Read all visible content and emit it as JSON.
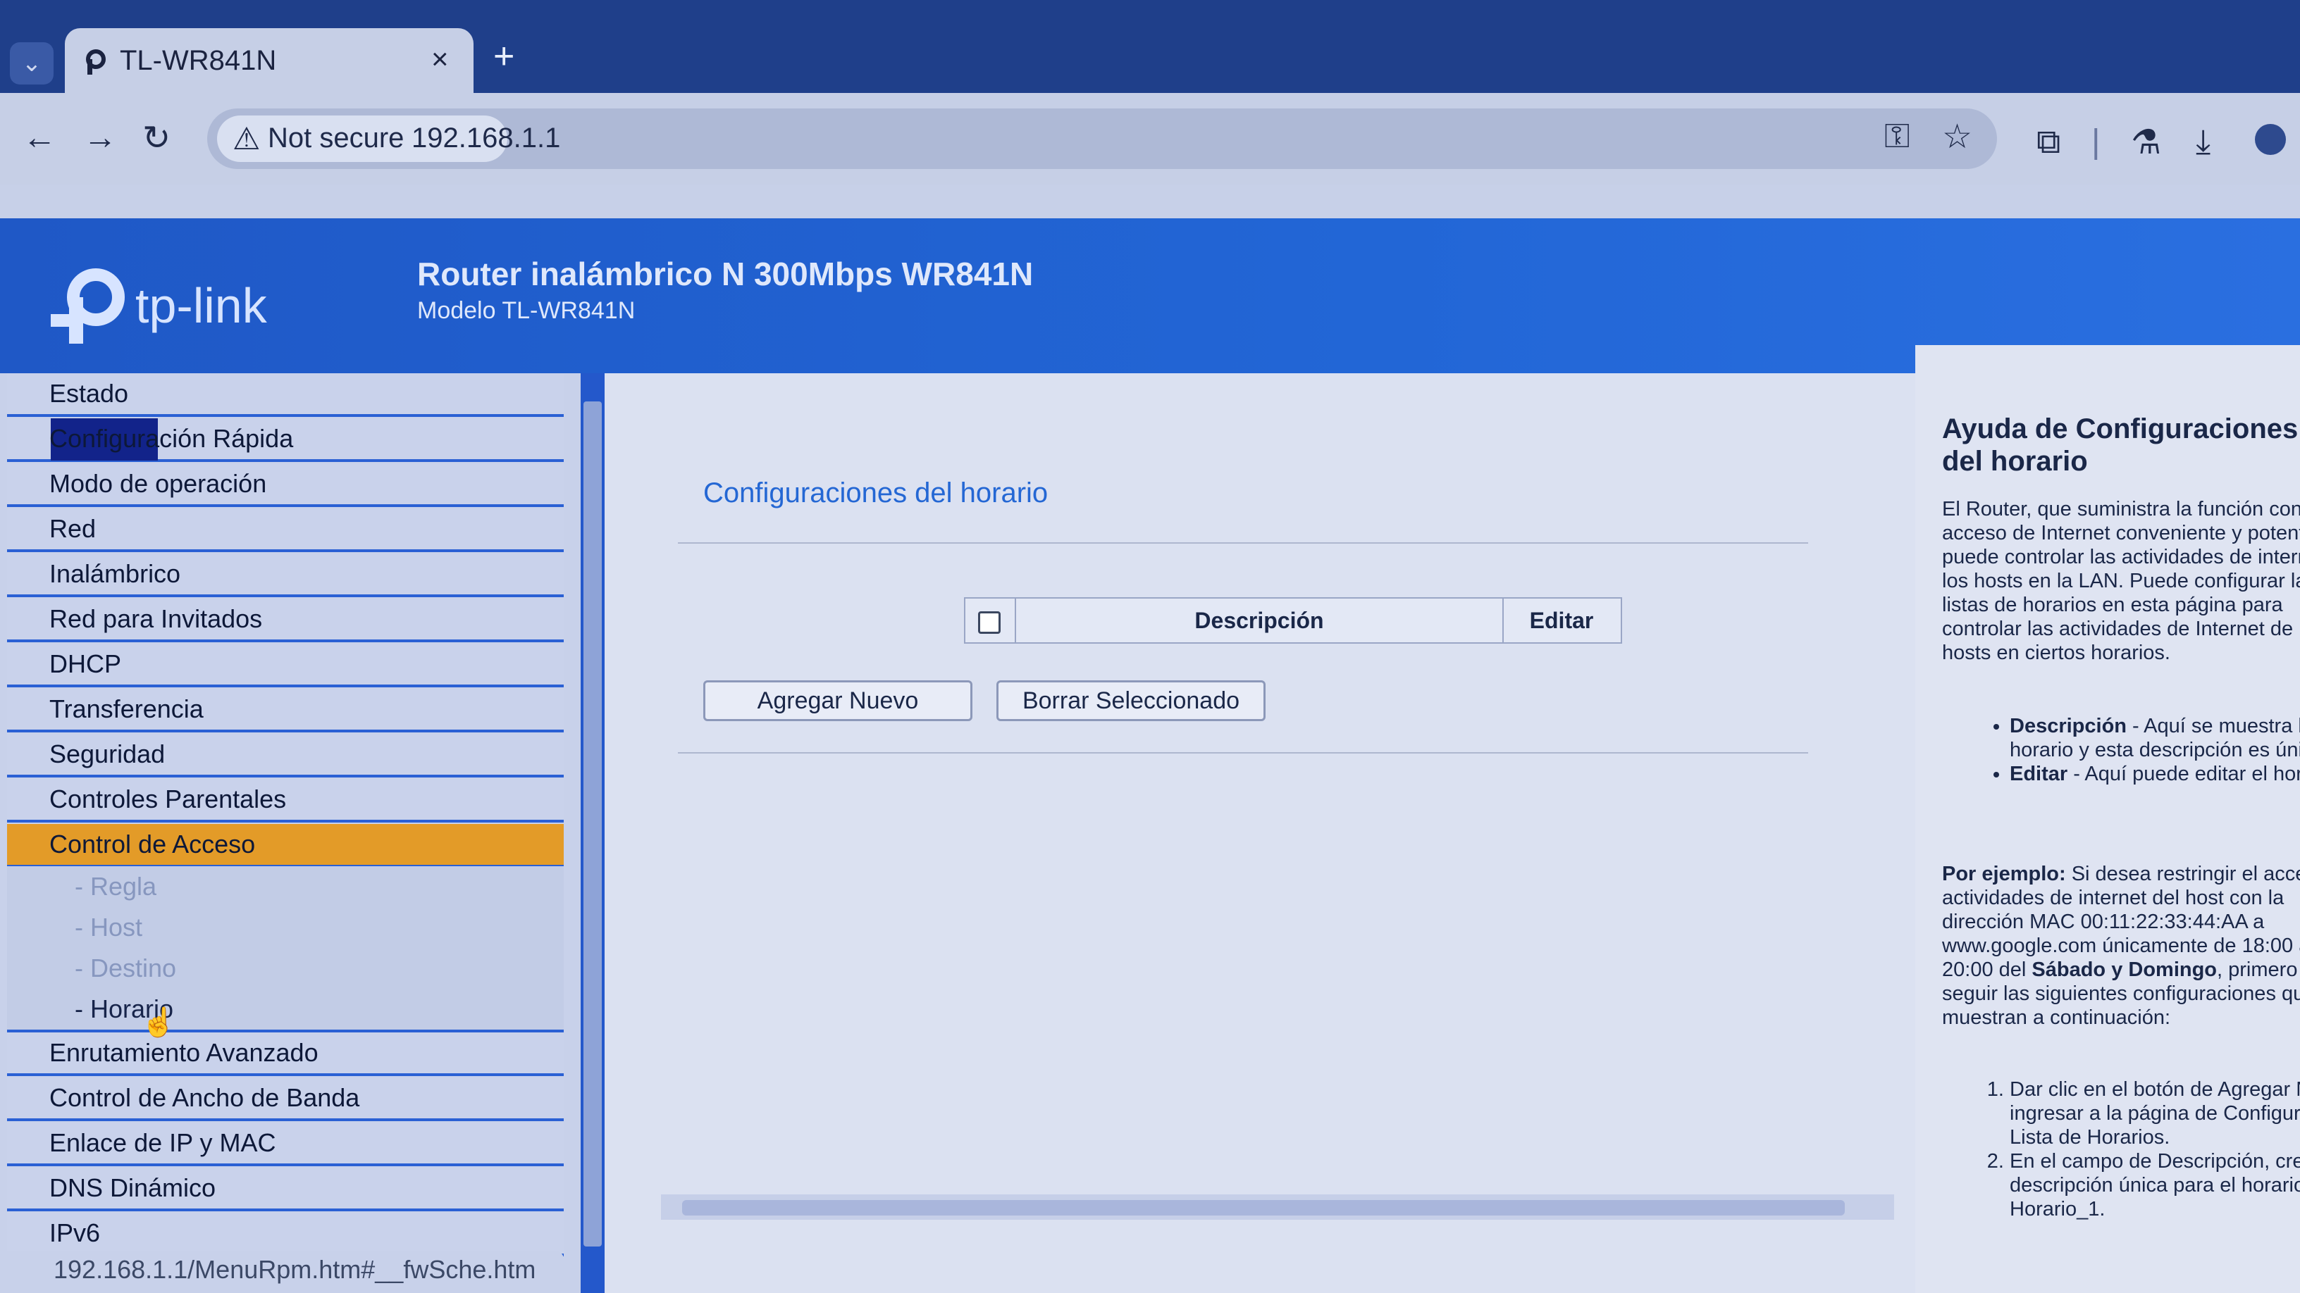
{
  "browser": {
    "tab_title": "TL-WR841N",
    "tab_close": "×",
    "new_tab": "+",
    "security_label": "Not secure",
    "url": "192.168.1.1",
    "icons": [
      "back-icon",
      "forward-icon",
      "reload-icon",
      "key-icon",
      "star-icon",
      "extensions-icon",
      "labs-icon",
      "download-icon",
      "profile-icon"
    ]
  },
  "router": {
    "logo_text": "tp-link",
    "title": "Router inalámbrico N 300Mbps WR841N",
    "model": "Modelo TL-WR841N"
  },
  "sidebar": {
    "items": [
      {
        "label": "Estado"
      },
      {
        "label": "Configuración Rápida"
      },
      {
        "label": "Modo de operación"
      },
      {
        "label": "Red"
      },
      {
        "label": "Inalámbrico"
      },
      {
        "label": "Red para Invitados"
      },
      {
        "label": "DHCP"
      },
      {
        "label": "Transferencia"
      },
      {
        "label": "Seguridad"
      },
      {
        "label": "Controles Parentales"
      },
      {
        "label": "Control de Acceso"
      },
      {
        "label": "- Regla"
      },
      {
        "label": "- Host"
      },
      {
        "label": "- Destino"
      },
      {
        "label": "- Horario"
      },
      {
        "label": "Enrutamiento Avanzado"
      },
      {
        "label": "Control de Ancho de Banda"
      },
      {
        "label": "Enlace de IP y MAC"
      },
      {
        "label": "DNS Dinámico"
      },
      {
        "label": "IPv6"
      }
    ],
    "active": "Control de Acceso"
  },
  "main": {
    "section_title": "Configuraciones del horario",
    "table": {
      "col_description": "Descripción",
      "col_edit": "Editar"
    },
    "buttons": {
      "add_new": "Agregar Nuevo",
      "delete_selected": "Borrar Seleccionado"
    }
  },
  "help": {
    "title": "Ayuda de Configuraciones del horario",
    "intro": "El Router, que suministra la función control de acceso de Internet conveniente y potente, puede controlar las actividades de internet de los hosts en la LAN. Puede configurar las listas de horarios en esta página para controlar las actividades de Internet de los hosts en ciertos horarios.",
    "bullets": [
      {
        "term": "Descripción",
        "text": " - Aquí se muestra la descripción del horario y esta descripción es única"
      },
      {
        "term": "Editar",
        "text": " - Aquí puede editar el horario existente."
      }
    ],
    "example": {
      "lead": "Por ejemplo:",
      "text1": " Si desea restringir el acceso a actividades de internet del host con la dirección MAC 00:11:22:33:44:AA a www.google.com únicamente de 18:00 a 20:00 del ",
      "days": "Sábado y Domingo",
      "text2": ", primero debe seguir las siguientes configuraciones que se muestran a continuación:"
    },
    "steps": [
      "Dar clic en el botón de Agregar Nuevo para ingresar a la página de Configuraciones de la Lista de Horarios.",
      "En el campo de Descripción, crear una descripción única para el horario, por ejemplo, Horario_1."
    ]
  },
  "statusbar": {
    "url": "192.168.1.1/MenuRpm.htm#__fwSche.htm"
  }
}
